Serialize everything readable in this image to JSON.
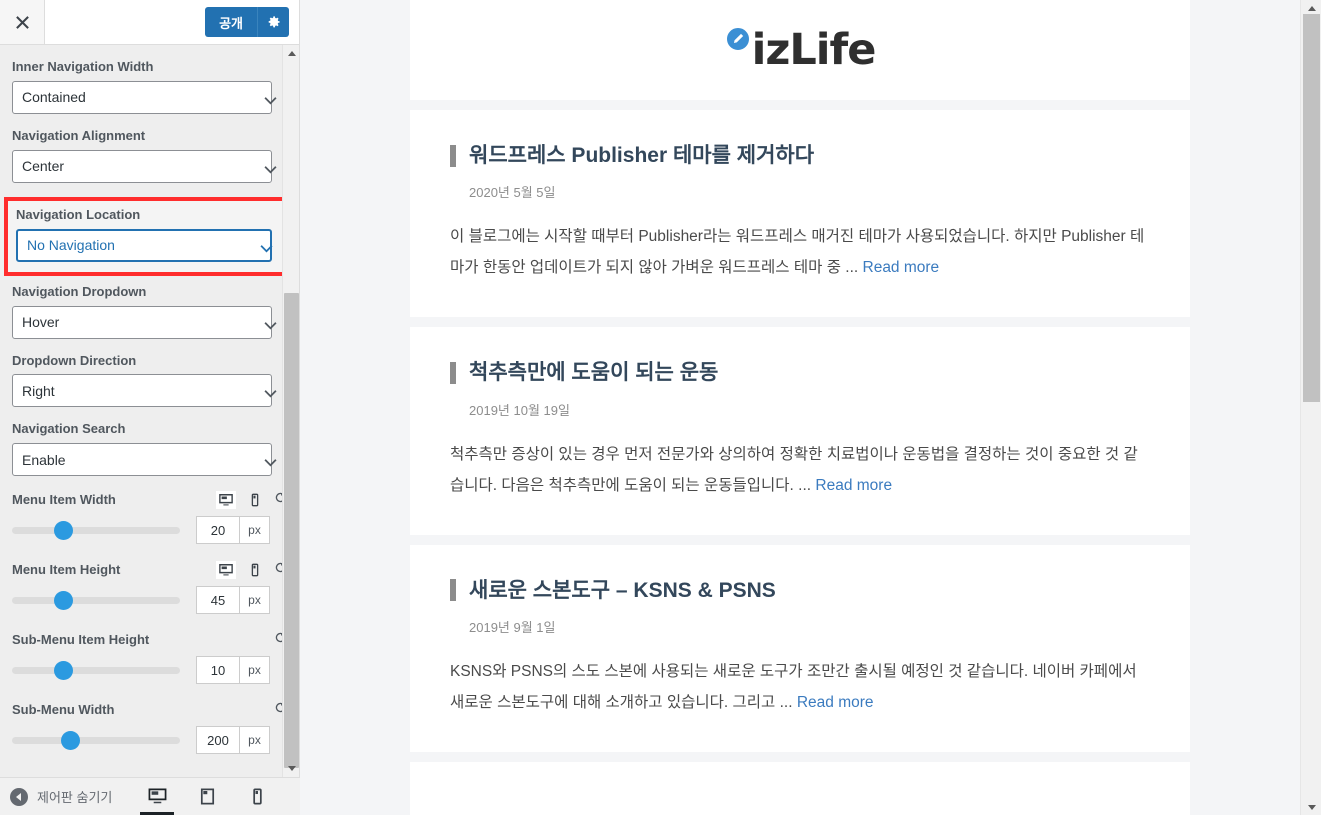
{
  "customizer": {
    "close_label": "×",
    "publish_label": "공개",
    "gear_name": "gear-icon",
    "controls": [
      {
        "label": "Inner Navigation Width",
        "value": "Contained",
        "type": "select"
      },
      {
        "label": "Navigation Alignment",
        "value": "Center",
        "type": "select"
      },
      {
        "label": "Navigation Location",
        "value": "No Navigation",
        "type": "select",
        "highlighted": true
      },
      {
        "label": "Navigation Dropdown",
        "value": "Hover",
        "type": "select"
      },
      {
        "label": "Dropdown Direction",
        "value": "Right",
        "type": "select"
      },
      {
        "label": "Navigation Search",
        "value": "Enable",
        "type": "select"
      }
    ],
    "sliders": [
      {
        "label": "Menu Item Width",
        "value": "20",
        "unit": "px",
        "pct": 25,
        "devices": true
      },
      {
        "label": "Menu Item Height",
        "value": "45",
        "unit": "px",
        "pct": 25,
        "devices": true
      },
      {
        "label": "Sub-Menu Item Height",
        "value": "10",
        "unit": "px",
        "pct": 25,
        "devices": false
      },
      {
        "label": "Sub-Menu Width",
        "value": "200",
        "unit": "px",
        "pct": 29,
        "devices": false
      }
    ],
    "footer": {
      "collapse_label": "제어판 숨기기",
      "devices": [
        {
          "name": "desktop",
          "active": true
        },
        {
          "name": "tablet",
          "active": false
        },
        {
          "name": "mobile",
          "active": false
        }
      ]
    }
  },
  "preview": {
    "site_title": "izLife",
    "posts": [
      {
        "title": "워드프레스 Publisher 테마를 제거하다",
        "date": "2020년 5월 5일",
        "excerpt": "이 블로그에는 시작할 때부터 Publisher라는 워드프레스 매거진 테마가 사용되었습니다. 하지만 Publisher 테마가 한동안 업데이트가 되지 않아 가벼운 워드프레스 테마 중 ... ",
        "read_more": "Read more"
      },
      {
        "title": "척추측만에 도움이 되는 운동",
        "date": "2019년 10월 19일",
        "excerpt": "척추측만 증상이 있는 경우 먼저 전문가와 상의하여 정확한 치료법이나 운동법을 결정하는 것이 중요한 것 같습니다. 다음은 척추측만에 도움이 되는 운동들입니다. ... ",
        "read_more": "Read more"
      },
      {
        "title": "새로운 스본도구 – KSNS & PSNS",
        "date": "2019년 9월 1일",
        "excerpt": "KSNS와 PSNS의 스도 스본에 사용되는 새로운 도구가 조만간 출시될 예정인 것 같습니다. 네이버 카페에서 새로운 스본도구에 대해 소개하고 있습니다. 그리고 ... ",
        "read_more": "Read more"
      }
    ]
  },
  "colors": {
    "accent": "#2271b1",
    "highlight": "#ff2d2d",
    "slider_thumb": "#2b9ae0",
    "link": "#3b7bbf"
  }
}
